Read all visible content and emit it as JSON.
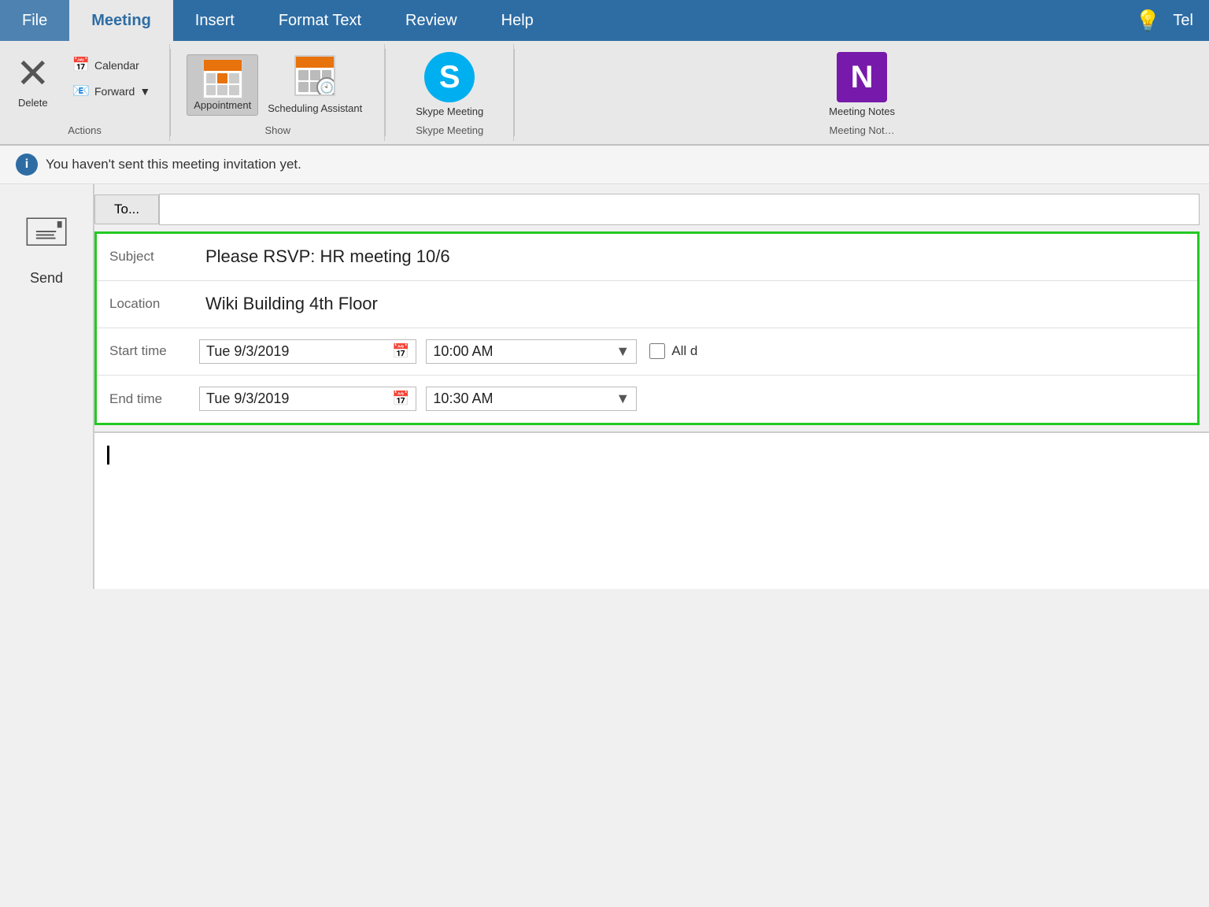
{
  "ribbon": {
    "tabs": [
      {
        "label": "File",
        "active": false
      },
      {
        "label": "Meeting",
        "active": true
      },
      {
        "label": "Insert",
        "active": false
      },
      {
        "label": "Format Text",
        "active": false
      },
      {
        "label": "Review",
        "active": false
      },
      {
        "label": "Help",
        "active": false
      },
      {
        "label": "Tel",
        "active": false
      }
    ],
    "actions_group": {
      "label": "Actions",
      "delete_label": "Delete",
      "calendar_label": "Calendar",
      "forward_label": "Forward"
    },
    "show_group": {
      "label": "Show",
      "appointment_label": "Appointment",
      "scheduling_label": "Scheduling\nAssistant"
    },
    "skype_group": {
      "label": "Skype Meeting",
      "skype_label": "Skype\nMeeting"
    },
    "meeting_notes_group": {
      "label": "Meeting Not…",
      "notes_label": "Meeting\nNotes"
    }
  },
  "notification": {
    "text": "You haven't sent this meeting invitation yet."
  },
  "form": {
    "to_label": "To...",
    "subject_label": "Subject",
    "subject_value": "Please RSVP: HR meeting 10/6",
    "location_label": "Location",
    "location_value": "Wiki Building 4th Floor",
    "start_time_label": "Start time",
    "start_date_value": "Tue 9/3/2019",
    "start_time_value": "10:00 AM",
    "end_time_label": "End time",
    "end_date_value": "Tue 9/3/2019",
    "end_time_value": "10:30 AM",
    "all_day_label": "All d"
  },
  "send": {
    "label": "Send"
  }
}
